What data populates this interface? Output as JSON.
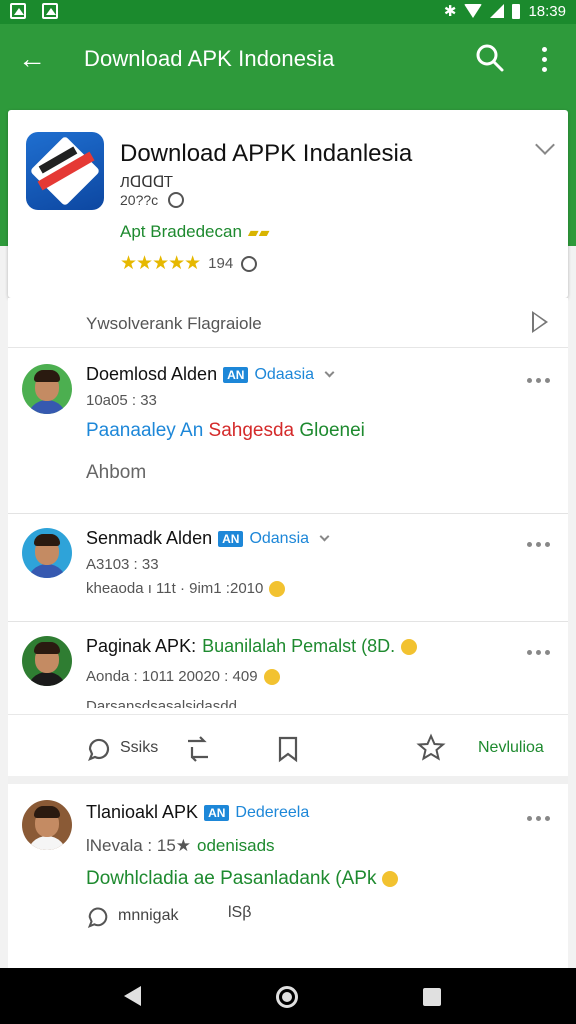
{
  "status_bar": {
    "time": "18:39"
  },
  "app_bar": {
    "title": "Download APK Indonesia",
    "back_icon": "arrow-back-icon",
    "search_icon": "search-icon",
    "more_icon": "more-vert-icon"
  },
  "colors": {
    "primary": "#2e9a3b",
    "status": "#1b8a2d",
    "accent_blue": "#1d87d8",
    "accent_green": "#1e8a2f",
    "accent_red": "#d42a2a",
    "star": "#e6b800"
  },
  "app": {
    "name": "Download APPK Indanlesia",
    "version": "ЛᗡᗡᗡᎢ",
    "date": "20??c",
    "developer": "Apt Bradedecan",
    "rating_value": "194",
    "stars": "★★★★★"
  },
  "feed": {
    "header_label": "Ywsolverank Flagraiole",
    "posts": [
      {
        "name": "Doemlosd Alden",
        "tag": "AN",
        "tag_text": "Odaasia",
        "meta": "10a05 : 33",
        "line1_a": "Paanaaley An",
        "line1_b": "Sahgesda",
        "line1_c": "Gloenei",
        "line2": "Ahbom"
      },
      {
        "name": "Senmadk Alden",
        "tag": "AN",
        "tag_text": "Odansia",
        "meta": "A3103 : 33",
        "line1": "kheaoda ı 11t  ·  9im1 :2010"
      },
      {
        "name": "Paginak APK:",
        "name_green": "Buanilalah Pemalst (8D.",
        "meta": "Aonda : 1011 20020 : 409",
        "cut": "Darsansdsasalsidasdd"
      },
      {
        "name": "Tlanioakl APK",
        "tag": "AN",
        "tag_text": "Dedereela",
        "meta": "lNevala : 15★",
        "meta_green": "odenisads",
        "line1": "Dowhlcladia ae Pasanladank (APk",
        "action1": "mnnigak",
        "action2": "lSβ"
      }
    ],
    "actions": {
      "share": "Ssiks",
      "like": "",
      "save": "",
      "star": "",
      "download": "Nevlulioa"
    }
  },
  "nav": {
    "back": "back-icon",
    "home": "home-icon",
    "recents": "recents-icon"
  }
}
